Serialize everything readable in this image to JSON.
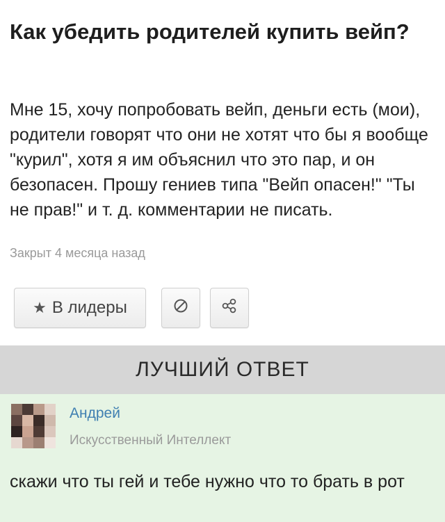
{
  "question": {
    "title": "Как убедить родителей купить вейп?",
    "body": "Мне 15, хочу попробовать вейп, деньги есть (мои), родители говорят что они не хотят что бы я вообще \"курил\", хотя я им объяснил что это пар, и он безопасен. Прошу гениев типа \"Вейп опасен!\" \"Ты не прав!\" и т. д. комментарии не писать.",
    "status": "Закрыт 4 месяца назад"
  },
  "actions": {
    "leaders_label": "В лидеры",
    "star_icon": "star-icon",
    "block_icon": "block-icon",
    "share_icon": "share-icon"
  },
  "best_answer": {
    "header": "ЛУЧШИЙ ОТВЕТ",
    "author_name": "Андрей",
    "author_rank": "Искусственный Интеллект",
    "text": "скажи что ты гей и тебе нужно что то брать в рот"
  },
  "colors": {
    "answer_bg": "#e6f4e4",
    "header_bg": "#d6d6d6",
    "author_link": "#3f7fb1",
    "muted": "#9a9a9a"
  }
}
